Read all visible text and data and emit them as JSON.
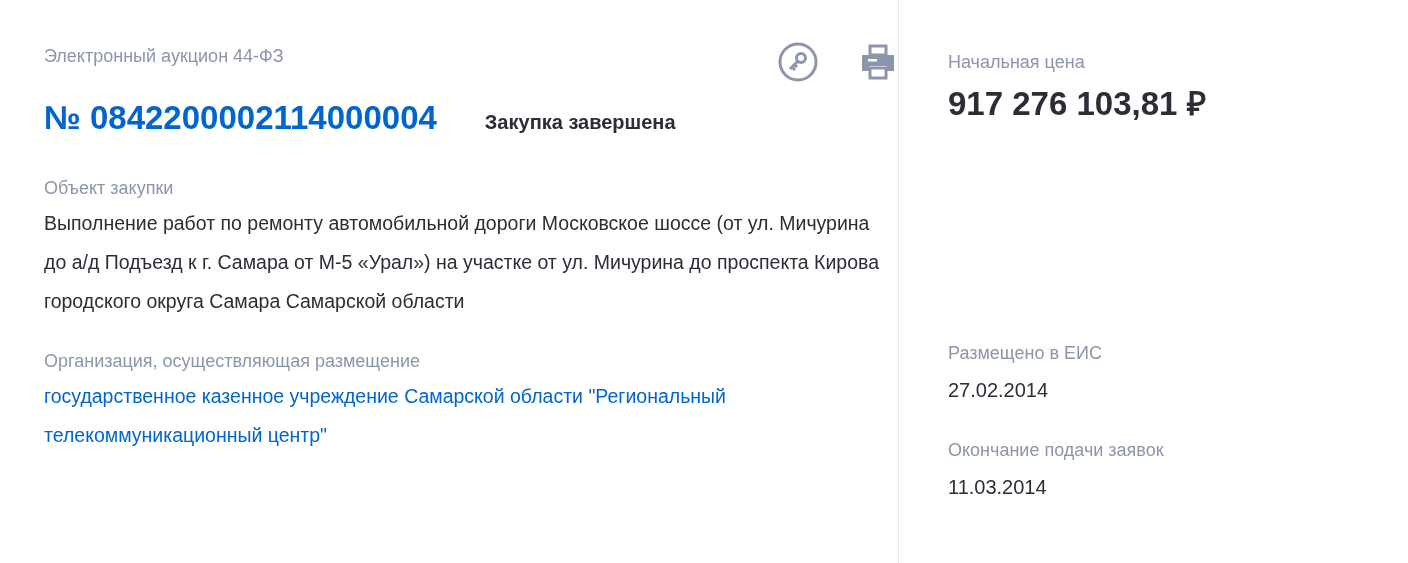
{
  "procurement": {
    "type": "Электронный аукцион 44-ФЗ",
    "number": "№ 0842200002114000004",
    "status": "Закупка завершена",
    "object_label": "Объект закупки",
    "object": "Выполнение работ по ремонту автомобильной дороги Московское шоссе (от ул. Мичурина до а/д Подъезд к г. Самара от М-5 «Урал») на участке от ул. Мичурина до проспекта Кирова городского округа Самара Самарской области",
    "organization_label": "Организация, осуществляющая размещение",
    "organization": "государственное казенное учреждение Самарской области \"Региональный телекоммуникационный центр\""
  },
  "price": {
    "label": "Начальная цена",
    "value": "917 276 103,81 ₽"
  },
  "dates": [
    {
      "label": "Размещено в ЕИС",
      "value": "27.02.2014"
    },
    {
      "label": "Окончание подачи заявок",
      "value": "11.03.2014"
    }
  ]
}
